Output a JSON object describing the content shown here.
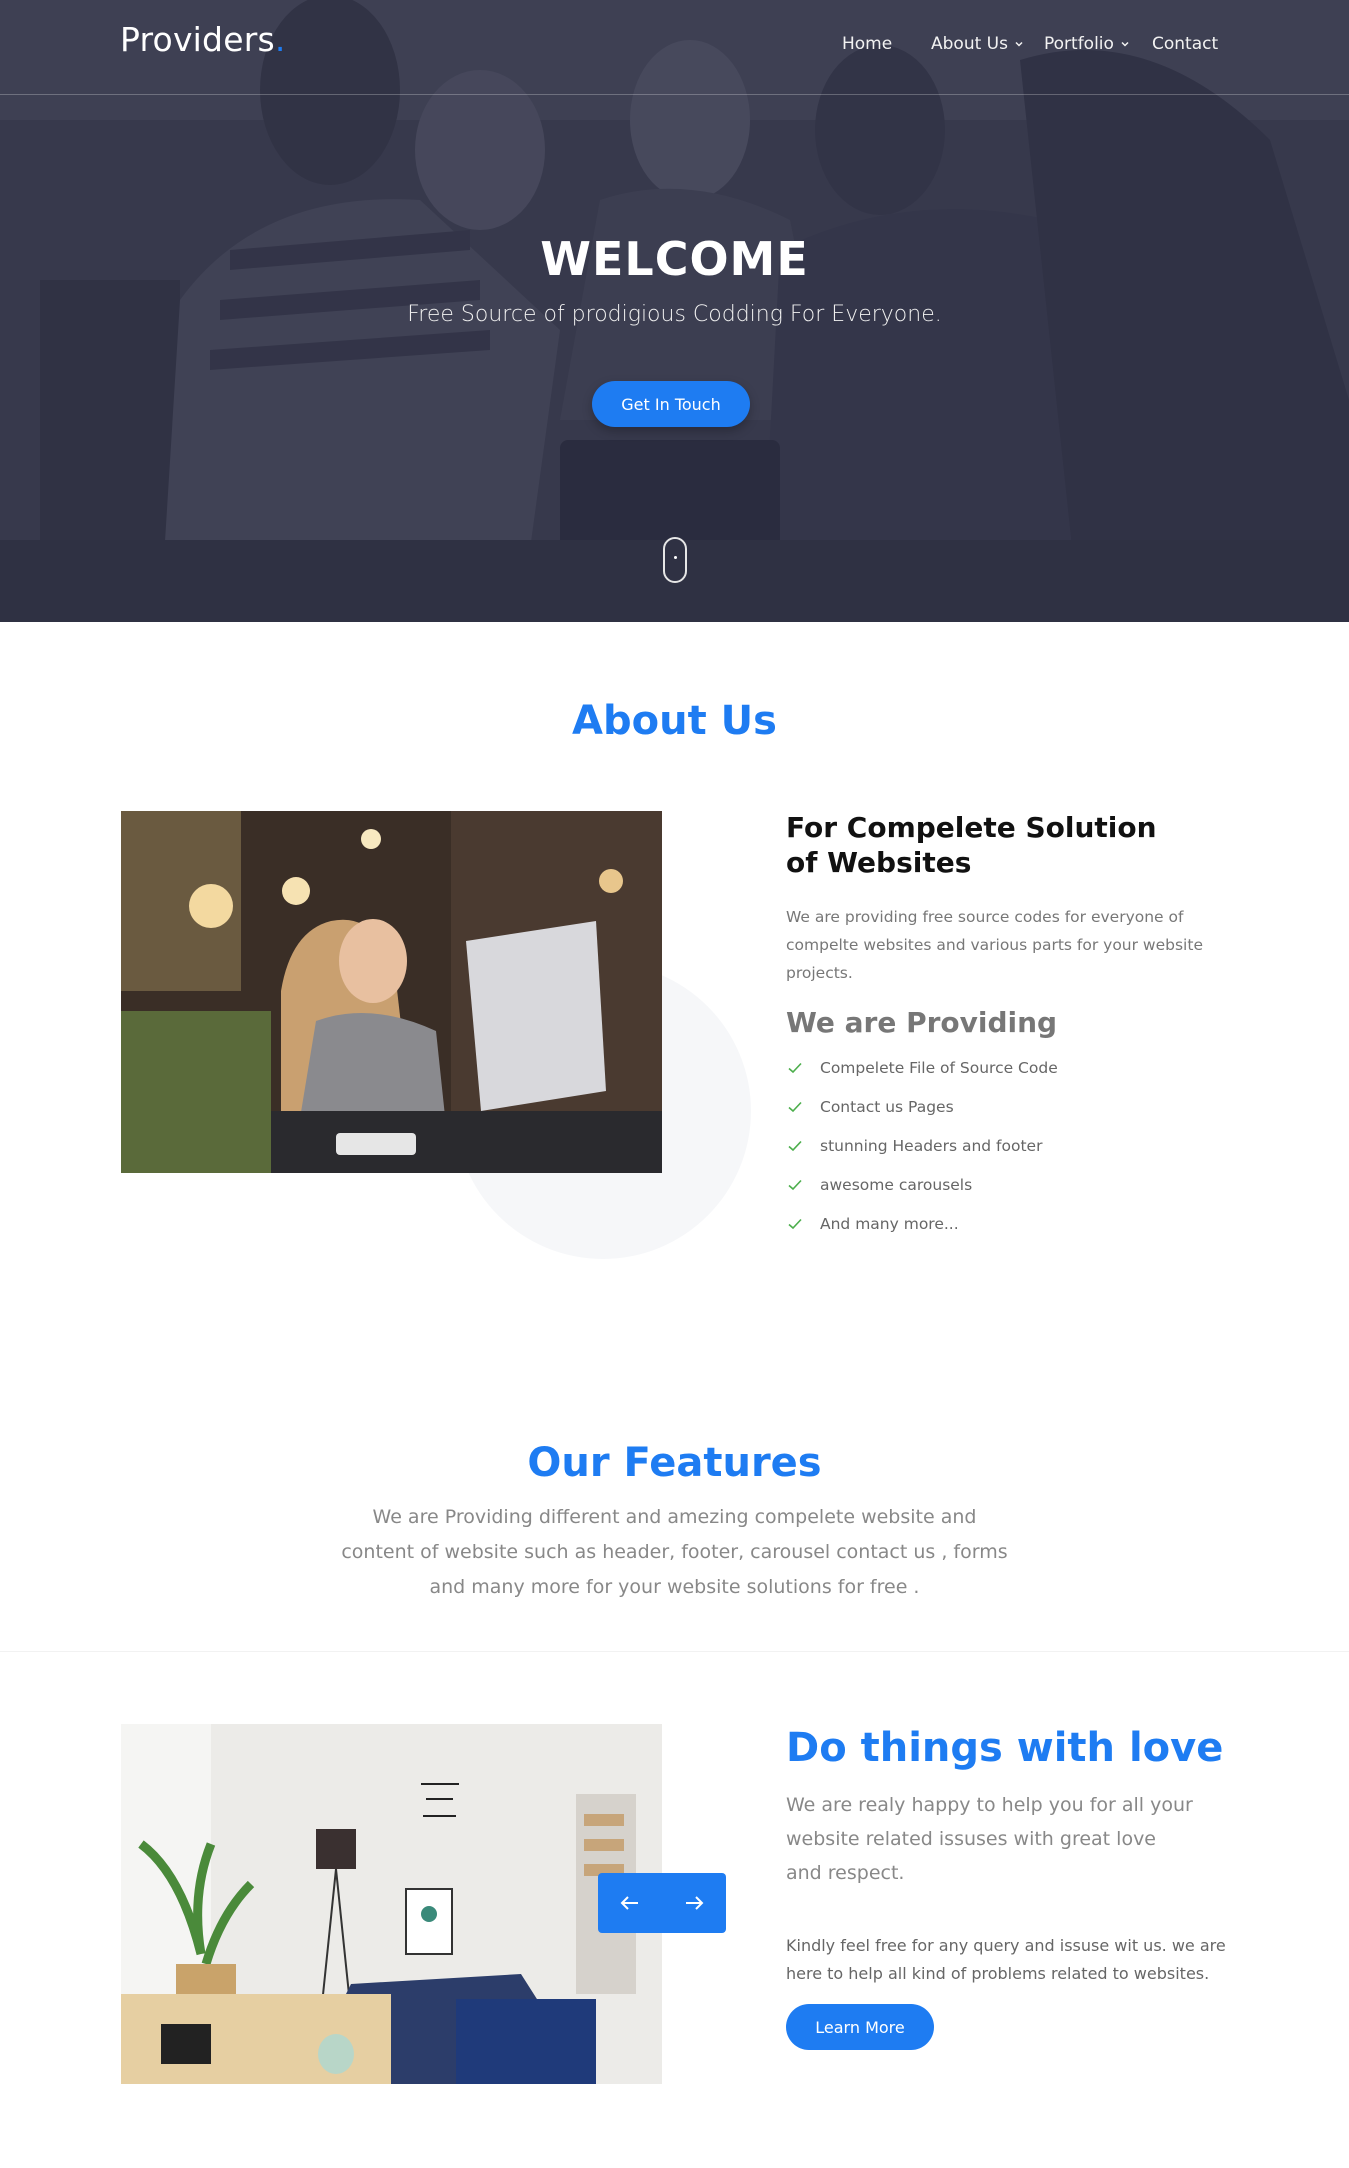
{
  "colors": {
    "accent": "#1e7cf2",
    "check": "#4cae4c",
    "hero_overlay": "#2a2c3e"
  },
  "navbar": {
    "brand": "Providers",
    "brand_dot": ".",
    "items": [
      {
        "label": "Home",
        "has_dropdown": false
      },
      {
        "label": "About Us",
        "has_dropdown": true
      },
      {
        "label": "Portfolio",
        "has_dropdown": true
      },
      {
        "label": "Contact",
        "has_dropdown": false
      }
    ]
  },
  "hero": {
    "title": "WELCOME",
    "subtitle": "Free Source of prodigious Codding For Everyone.",
    "button": "Get In Touch",
    "scroll_icon": "mouse-scroll-icon"
  },
  "about": {
    "title": "About Us",
    "heading": "For Compelete Solution of Websites",
    "text": "We are providing free source codes for everyone of compelte websites and various parts for your website projects.",
    "providing_title": "We are Providing",
    "list": [
      "Compelete File of Source Code",
      "Contact us Pages",
      "stunning Headers and footer",
      "awesome carousels",
      "And many more..."
    ]
  },
  "features": {
    "title": "Our Features",
    "text": "We are Providing different and amezing compelete website and content of website such as header, footer, carousel contact us , forms and many more for your website solutions for free ."
  },
  "love": {
    "title": "Do things with love",
    "text": "We are realy happy to help you for all your website related issuses with great love and respect.",
    "text2": "Kindly feel free for any query and issuse wit us. we are here to help all kind of problems related to websites.",
    "button": "Learn More",
    "prev_icon": "arrow-left-icon",
    "next_icon": "arrow-right-icon"
  }
}
